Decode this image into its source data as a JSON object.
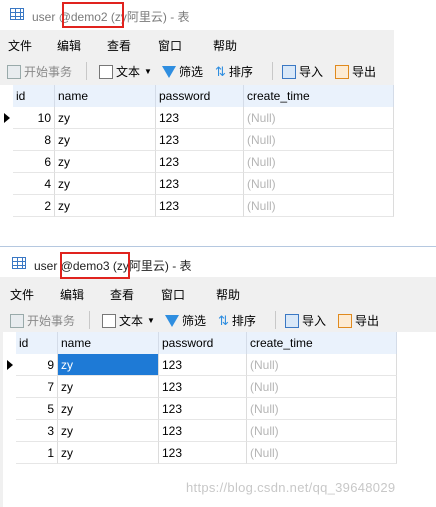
{
  "window1": {
    "title_prefix": "user ",
    "title_db": "@demo2",
    "title_suffix": " (zy阿里云) - 表",
    "menu": [
      "文件",
      "编辑",
      "查看",
      "窗口",
      "帮助"
    ],
    "toolbar": {
      "begin_transaction": "开始事务",
      "text": "文本",
      "filter": "筛选",
      "sort": "排序",
      "import": "导入",
      "export": "导出"
    },
    "columns": [
      "id",
      "name",
      "password",
      "create_time"
    ],
    "rows": [
      {
        "id": "10",
        "name": "zy",
        "password": "123",
        "create_time": "(Null)"
      },
      {
        "id": "8",
        "name": "zy",
        "password": "123",
        "create_time": "(Null)"
      },
      {
        "id": "6",
        "name": "zy",
        "password": "123",
        "create_time": "(Null)"
      },
      {
        "id": "4",
        "name": "zy",
        "password": "123",
        "create_time": "(Null)"
      },
      {
        "id": "2",
        "name": "zy",
        "password": "123",
        "create_time": "(Null)"
      }
    ]
  },
  "window2": {
    "title_prefix": "user ",
    "title_db": "@demo3",
    "title_suffix": " (zy阿里云) - 表",
    "menu": [
      "文件",
      "编辑",
      "查看",
      "窗口",
      "帮助"
    ],
    "toolbar": {
      "begin_transaction": "开始事务",
      "text": "文本",
      "filter": "筛选",
      "sort": "排序",
      "import": "导入",
      "export": "导出"
    },
    "columns": [
      "id",
      "name",
      "password",
      "create_time"
    ],
    "rows": [
      {
        "id": "9",
        "name": "zy",
        "password": "123",
        "create_time": "(Null)"
      },
      {
        "id": "7",
        "name": "zy",
        "password": "123",
        "create_time": "(Null)"
      },
      {
        "id": "5",
        "name": "zy",
        "password": "123",
        "create_time": "(Null)"
      },
      {
        "id": "3",
        "name": "zy",
        "password": "123",
        "create_time": "(Null)"
      },
      {
        "id": "1",
        "name": "zy",
        "password": "123",
        "create_time": "(Null)"
      }
    ]
  },
  "colors": {
    "highlight_box": "#e0231e",
    "selection": "#1e7ad6",
    "null_text": "#b5b5b5"
  },
  "watermark": "https://blog.csdn.net/qq_39648029"
}
